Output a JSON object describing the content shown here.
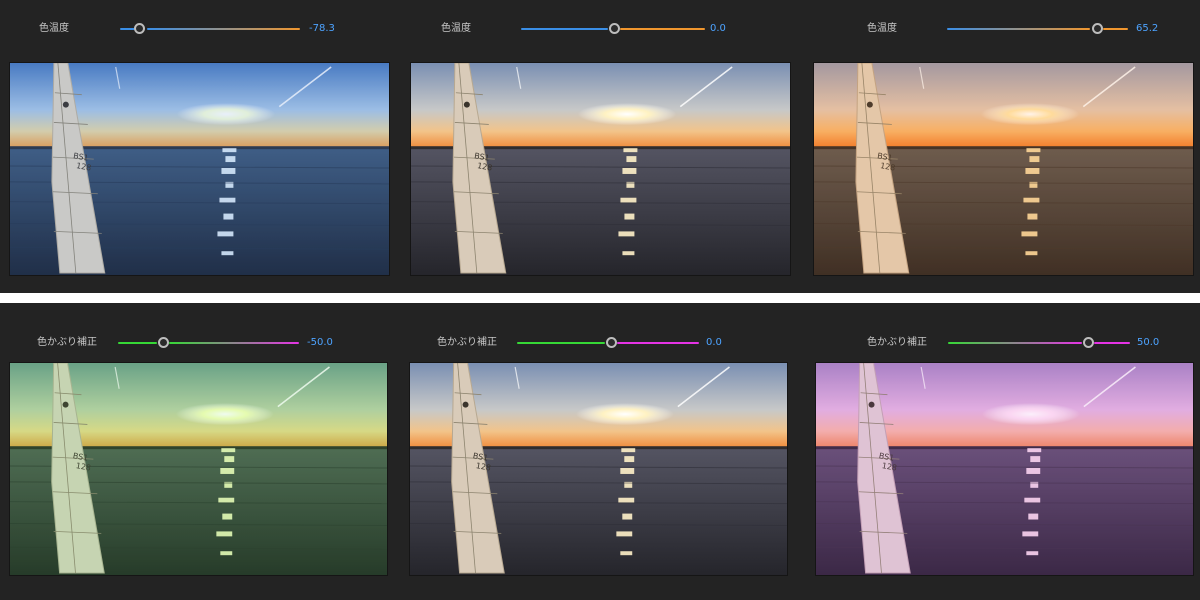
{
  "top": {
    "label": "色温度",
    "panels": [
      {
        "value": "-78.3",
        "level": -0.783
      },
      {
        "value": "0.0",
        "level": 0.0
      },
      {
        "value": "65.2",
        "level": 0.652
      }
    ],
    "colors": {
      "low": "#3a8ee6",
      "high": "#f0962e"
    }
  },
  "bottom": {
    "label": "色かぶり補正",
    "panels": [
      {
        "value": "-50.0",
        "level": -0.5
      },
      {
        "value": "0.0",
        "level": 0.0
      },
      {
        "value": "50.0",
        "level": 0.5
      }
    ],
    "colors": {
      "low": "#36d836",
      "high": "#e533e5"
    }
  },
  "photo": {
    "sail_text": "BS1\n128",
    "tints": {
      "cool": "#3f7fe0",
      "neutral": "#000000",
      "warm": "#ff8a2a",
      "green": "#5fd45f",
      "magenta": "#d35fd3"
    }
  }
}
